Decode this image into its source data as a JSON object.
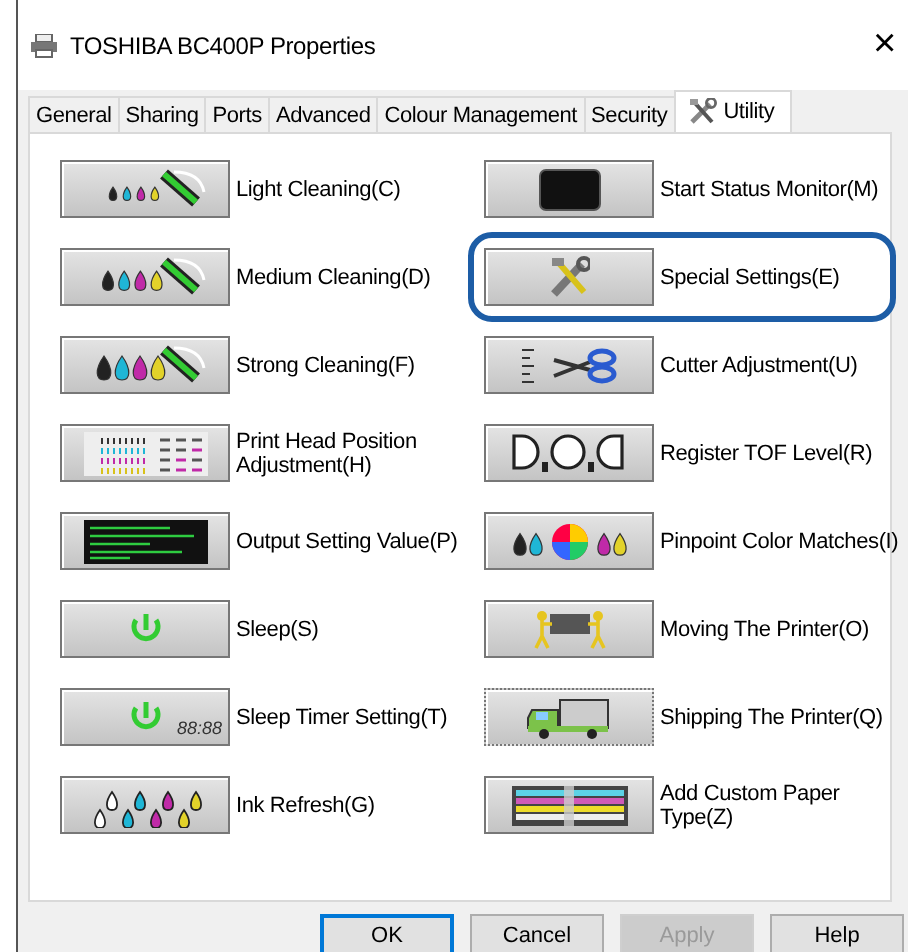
{
  "window": {
    "title": "TOSHIBA BC400P Properties",
    "close": "×"
  },
  "tabs": [
    {
      "label": "General",
      "selected": false
    },
    {
      "label": "Sharing",
      "selected": false
    },
    {
      "label": "Ports",
      "selected": false
    },
    {
      "label": "Advanced",
      "selected": false
    },
    {
      "label": "Colour Management",
      "selected": false
    },
    {
      "label": "Security",
      "selected": false
    },
    {
      "label": "Utility",
      "selected": true,
      "kind": "tools"
    }
  ],
  "utilities": [
    {
      "label": "Light Cleaning(C)",
      "kind": "light-cleaning",
      "highlighted": false
    },
    {
      "label": "Start Status Monitor(M)",
      "kind": "status-monitor",
      "highlighted": false
    },
    {
      "label": "Medium Cleaning(D)",
      "kind": "medium-cleaning",
      "highlighted": false
    },
    {
      "label": "Special Settings(E)",
      "kind": "special-settings",
      "highlighted": true
    },
    {
      "label": "Strong Cleaning(F)",
      "kind": "strong-cleaning",
      "highlighted": false
    },
    {
      "label": "Cutter Adjustment(U)",
      "kind": "cutter",
      "highlighted": false
    },
    {
      "label": "Print Head Position Adjustment(H)",
      "kind": "head-position",
      "highlighted": false
    },
    {
      "label": "Register TOF Level(R)",
      "kind": "register-tof",
      "highlighted": false
    },
    {
      "label": "Output Setting Value(P)",
      "kind": "output-setting",
      "highlighted": false
    },
    {
      "label": "Pinpoint Color Matches(I)",
      "kind": "pinpoint",
      "highlighted": false
    },
    {
      "label": "Sleep(S)",
      "kind": "sleep",
      "highlighted": false
    },
    {
      "label": "Moving The Printer(O)",
      "kind": "moving",
      "highlighted": false
    },
    {
      "label": "Sleep Timer Setting(T)",
      "kind": "sleep-timer",
      "display": "88:88",
      "highlighted": false
    },
    {
      "label": "Shipping The Printer(Q)",
      "kind": "shipping",
      "highlighted": false
    },
    {
      "label": "Ink Refresh(G)",
      "kind": "ink-refresh",
      "highlighted": false
    },
    {
      "label": "Add Custom Paper Type(Z)",
      "kind": "custom-paper",
      "highlighted": false
    }
  ],
  "buttons": [
    {
      "label": "OK",
      "default": true,
      "disabled": false
    },
    {
      "label": "Cancel",
      "default": false,
      "disabled": false
    },
    {
      "label": "Apply",
      "default": false,
      "disabled": true
    },
    {
      "label": "Help",
      "default": false,
      "disabled": false
    }
  ]
}
